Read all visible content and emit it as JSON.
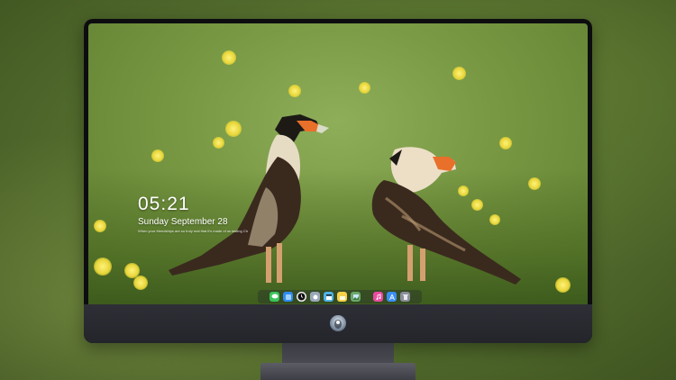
{
  "lock_screen": {
    "time": "05:21",
    "date": "Sunday September  28",
    "note": "When your friendships are so truly real that it's made of us lasting Ch"
  },
  "dock": {
    "icons": [
      {
        "name": "messages-icon",
        "color": "#3bc45a"
      },
      {
        "name": "finder-icon",
        "color": "#2d8cf0"
      },
      {
        "name": "clock-icon",
        "color": "#f2f2f2"
      },
      {
        "name": "photos-icon",
        "color": "#9aa7b8"
      },
      {
        "name": "claquette-icon",
        "color": "#4fb3e8"
      },
      {
        "name": "notes-icon",
        "color": "#f7d04a"
      },
      {
        "name": "preview-icon",
        "color": "#6aa86a"
      },
      {
        "name": "music-icon",
        "color": "#e84aa0"
      },
      {
        "name": "appstore-icon",
        "color": "#3a8ef5"
      },
      {
        "name": "trash-icon",
        "color": "#8a8f99"
      }
    ]
  },
  "monitor": {
    "logo": "apple-logo"
  }
}
